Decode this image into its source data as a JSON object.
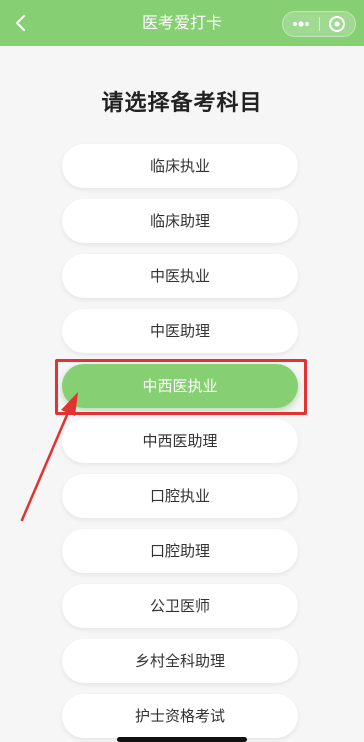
{
  "header": {
    "title": "医考爱打卡",
    "back_icon": "chevron-left-icon",
    "more_icon": "more-dots-icon",
    "close_icon": "target-circle-icon",
    "background_color": "#86cf72"
  },
  "main": {
    "heading": "请选择备考科目",
    "selected_index": 4,
    "subjects": [
      {
        "label": "临床执业"
      },
      {
        "label": "临床助理"
      },
      {
        "label": "中医执业"
      },
      {
        "label": "中医助理"
      },
      {
        "label": "中西医执业"
      },
      {
        "label": "中西医助理"
      },
      {
        "label": "口腔执业"
      },
      {
        "label": "口腔助理"
      },
      {
        "label": "公卫医师"
      },
      {
        "label": "乡村全科助理"
      },
      {
        "label": "护士资格考试"
      }
    ]
  },
  "colors": {
    "accent_green": "#86cf72",
    "highlight_red": "#e43131"
  }
}
